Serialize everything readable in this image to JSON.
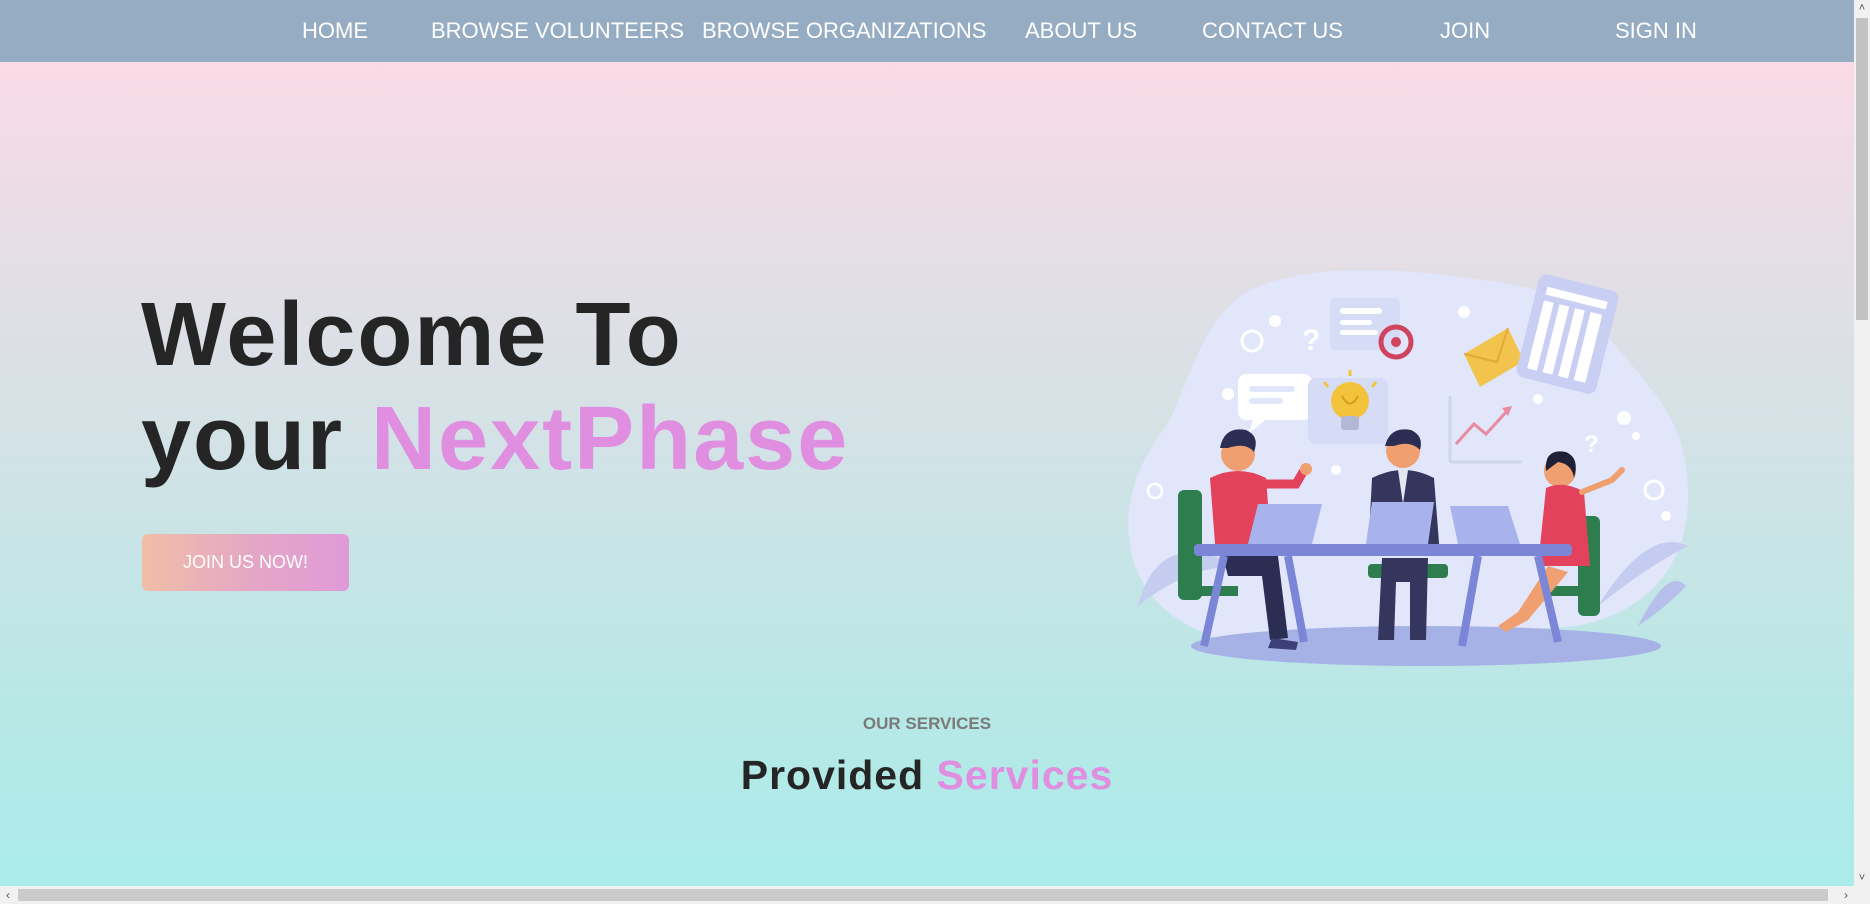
{
  "nav": {
    "home": "HOME",
    "browse_volunteers": "BROWSE VOLUNTEERS",
    "browse_organizations": "BROWSE ORGANIZATIONS",
    "about_us": "ABOUT US",
    "contact_us": "CONTACT US",
    "join": "JOIN",
    "sign_in": "SIGN IN"
  },
  "hero": {
    "line1": "Welcome To",
    "line2_prefix": "your ",
    "brand": "NextPhase",
    "cta": "JOIN US NOW!"
  },
  "services": {
    "eyebrow": "OUR SERVICES",
    "title_prefix": "Provided ",
    "title_accent": "Services"
  },
  "colors": {
    "nav_bg": "#95acc2",
    "accent": "#e08fe0",
    "heading": "#252525"
  },
  "icons": {
    "illustration": "team-meeting-illustration",
    "scroll_up": "chevron-up-icon",
    "scroll_down": "chevron-down-icon",
    "scroll_left": "chevron-left-icon",
    "scroll_right": "chevron-right-icon"
  }
}
